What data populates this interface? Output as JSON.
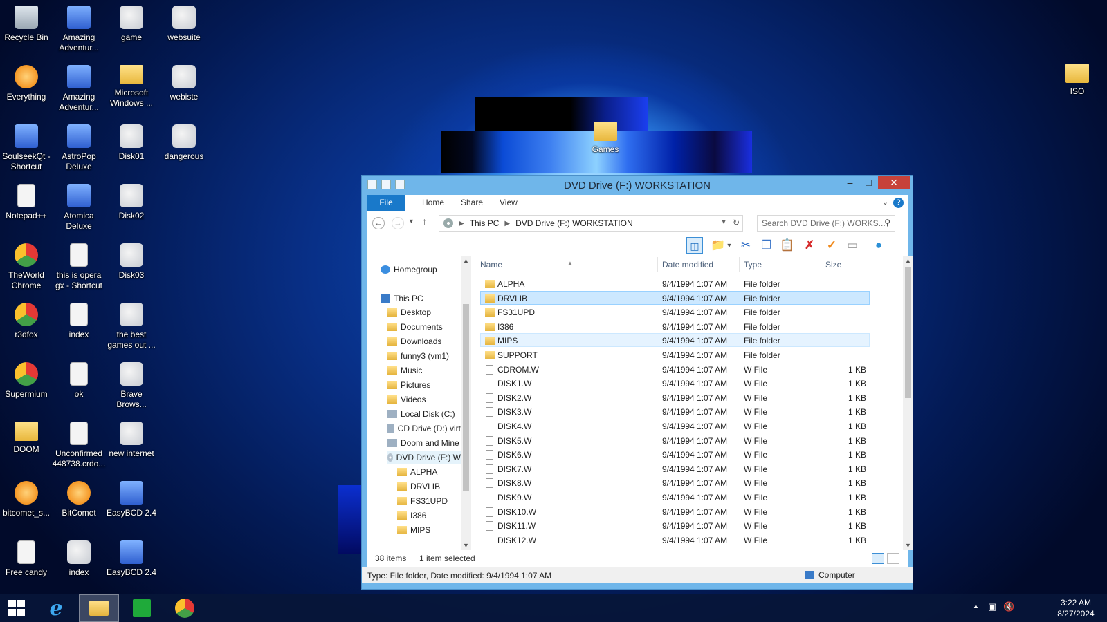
{
  "desktop": {
    "icons": [
      {
        "label": "Recycle Bin",
        "icon": "recycle-bin-icon"
      },
      {
        "label": "Amazing Adventur...",
        "icon": "game-app-icon"
      },
      {
        "label": "game",
        "icon": "globe-shortcut-icon"
      },
      {
        "label": "websuite",
        "icon": "globe-shortcut-icon"
      },
      {
        "label": "Everything",
        "icon": "search-app-icon"
      },
      {
        "label": "Amazing Adventur...",
        "icon": "game-app-icon"
      },
      {
        "label": "Microsoft Windows ...",
        "icon": "folder-icon"
      },
      {
        "label": "webiste",
        "icon": "globe-shortcut-icon"
      },
      {
        "label": "SoulseekQt - Shortcut",
        "icon": "app-icon"
      },
      {
        "label": "AstroPop Deluxe",
        "icon": "game-app-icon"
      },
      {
        "label": "Disk01",
        "icon": "disk-image-icon"
      },
      {
        "label": "dangerous",
        "icon": "globe-shortcut-icon"
      },
      {
        "label": "Notepad++",
        "icon": "notepad-icon"
      },
      {
        "label": "Atomica Deluxe",
        "icon": "game-app-icon"
      },
      {
        "label": "Disk02",
        "icon": "disk-image-icon"
      },
      {
        "label": "TheWorld Chrome",
        "icon": "browser-icon"
      },
      {
        "label": "this is opera gx - Shortcut",
        "icon": "document-icon"
      },
      {
        "label": "Disk03",
        "icon": "disk-image-icon"
      },
      {
        "label": "r3dfox",
        "icon": "browser-icon"
      },
      {
        "label": "index",
        "icon": "document-icon"
      },
      {
        "label": "the best games out ...",
        "icon": "globe-shortcut-icon"
      },
      {
        "label": "Supermium",
        "icon": "browser-icon"
      },
      {
        "label": "ok",
        "icon": "document-icon"
      },
      {
        "label": "Brave Brows...",
        "icon": "globe-shortcut-icon"
      },
      {
        "label": "DOOM",
        "icon": "folder-icon"
      },
      {
        "label": "Unconfirmed 448738.crdo...",
        "icon": "document-icon"
      },
      {
        "label": "new internet",
        "icon": "globe-shortcut-icon"
      },
      {
        "label": "bitcomet_s...",
        "icon": "bitcomet-icon"
      },
      {
        "label": "BitComet",
        "icon": "bitcomet-icon"
      },
      {
        "label": "EasyBCD 2.4",
        "icon": "app-icon"
      },
      {
        "label": "Free candy",
        "icon": "document-icon"
      },
      {
        "label": "index",
        "icon": "globe-shortcut-icon"
      },
      {
        "label": "EasyBCD 2.4",
        "icon": "app-icon"
      },
      {
        "label": "ISO",
        "icon": "folder-icon"
      },
      {
        "label": "Games",
        "icon": "folder-icon"
      }
    ]
  },
  "window": {
    "title": "DVD Drive (F:) WORKSTATION",
    "ribbon_tabs": [
      "File",
      "Home",
      "Share",
      "View"
    ],
    "address": {
      "crumbs": [
        "This PC",
        "DVD Drive (F:) WORKSTATION"
      ]
    },
    "search_placeholder": "Search DVD Drive (F:) WORKS...",
    "columns": {
      "name": "Name",
      "date": "Date modified",
      "type": "Type",
      "size": "Size"
    },
    "nav": [
      {
        "label": "Homegroup",
        "icon": "home",
        "indent": 0
      },
      {
        "label": "This PC",
        "icon": "pc",
        "indent": 0
      },
      {
        "label": "Desktop",
        "icon": "fold",
        "indent": 1
      },
      {
        "label": "Documents",
        "icon": "fold",
        "indent": 1
      },
      {
        "label": "Downloads",
        "icon": "fold",
        "indent": 1
      },
      {
        "label": "funny3 (vm1)",
        "icon": "fold",
        "indent": 1
      },
      {
        "label": "Music",
        "icon": "fold",
        "indent": 1
      },
      {
        "label": "Pictures",
        "icon": "fold",
        "indent": 1
      },
      {
        "label": "Videos",
        "icon": "fold",
        "indent": 1
      },
      {
        "label": "Local Disk (C:)",
        "icon": "drive",
        "indent": 1
      },
      {
        "label": "CD Drive (D:) virt",
        "icon": "drive",
        "indent": 1
      },
      {
        "label": "Doom and Mine",
        "icon": "drive",
        "indent": 1
      },
      {
        "label": "DVD Drive (F:) W",
        "icon": "disc",
        "indent": 1
      },
      {
        "label": "ALPHA",
        "icon": "fold",
        "indent": 2
      },
      {
        "label": "DRVLIB",
        "icon": "fold",
        "indent": 2
      },
      {
        "label": "FS31UPD",
        "icon": "fold",
        "indent": 2
      },
      {
        "label": "I386",
        "icon": "fold",
        "indent": 2
      },
      {
        "label": "MIPS",
        "icon": "fold",
        "indent": 2
      }
    ],
    "files": [
      {
        "name": "ALPHA",
        "date": "9/4/1994 1:07 AM",
        "type": "File folder",
        "size": "",
        "kind": "folder",
        "state": ""
      },
      {
        "name": "DRVLIB",
        "date": "9/4/1994 1:07 AM",
        "type": "File folder",
        "size": "",
        "kind": "folder",
        "state": "sel"
      },
      {
        "name": "FS31UPD",
        "date": "9/4/1994 1:07 AM",
        "type": "File folder",
        "size": "",
        "kind": "folder",
        "state": ""
      },
      {
        "name": "I386",
        "date": "9/4/1994 1:07 AM",
        "type": "File folder",
        "size": "",
        "kind": "folder",
        "state": ""
      },
      {
        "name": "MIPS",
        "date": "9/4/1994 1:07 AM",
        "type": "File folder",
        "size": "",
        "kind": "folder",
        "state": "hover"
      },
      {
        "name": "SUPPORT",
        "date": "9/4/1994 1:07 AM",
        "type": "File folder",
        "size": "",
        "kind": "folder",
        "state": ""
      },
      {
        "name": "CDROM.W",
        "date": "9/4/1994 1:07 AM",
        "type": "W File",
        "size": "1 KB",
        "kind": "file",
        "state": ""
      },
      {
        "name": "DISK1.W",
        "date": "9/4/1994 1:07 AM",
        "type": "W File",
        "size": "1 KB",
        "kind": "file",
        "state": ""
      },
      {
        "name": "DISK2.W",
        "date": "9/4/1994 1:07 AM",
        "type": "W File",
        "size": "1 KB",
        "kind": "file",
        "state": ""
      },
      {
        "name": "DISK3.W",
        "date": "9/4/1994 1:07 AM",
        "type": "W File",
        "size": "1 KB",
        "kind": "file",
        "state": ""
      },
      {
        "name": "DISK4.W",
        "date": "9/4/1994 1:07 AM",
        "type": "W File",
        "size": "1 KB",
        "kind": "file",
        "state": ""
      },
      {
        "name": "DISK5.W",
        "date": "9/4/1994 1:07 AM",
        "type": "W File",
        "size": "1 KB",
        "kind": "file",
        "state": ""
      },
      {
        "name": "DISK6.W",
        "date": "9/4/1994 1:07 AM",
        "type": "W File",
        "size": "1 KB",
        "kind": "file",
        "state": ""
      },
      {
        "name": "DISK7.W",
        "date": "9/4/1994 1:07 AM",
        "type": "W File",
        "size": "1 KB",
        "kind": "file",
        "state": ""
      },
      {
        "name": "DISK8.W",
        "date": "9/4/1994 1:07 AM",
        "type": "W File",
        "size": "1 KB",
        "kind": "file",
        "state": ""
      },
      {
        "name": "DISK9.W",
        "date": "9/4/1994 1:07 AM",
        "type": "W File",
        "size": "1 KB",
        "kind": "file",
        "state": ""
      },
      {
        "name": "DISK10.W",
        "date": "9/4/1994 1:07 AM",
        "type": "W File",
        "size": "1 KB",
        "kind": "file",
        "state": ""
      },
      {
        "name": "DISK11.W",
        "date": "9/4/1994 1:07 AM",
        "type": "W File",
        "size": "1 KB",
        "kind": "file",
        "state": ""
      },
      {
        "name": "DISK12.W",
        "date": "9/4/1994 1:07 AM",
        "type": "W File",
        "size": "1 KB",
        "kind": "file",
        "state": ""
      }
    ],
    "status": {
      "count": "38 items",
      "selected": "1 item selected"
    },
    "details": {
      "text": "Type: File folder, Date modified: 9/4/1994 1:07 AM",
      "location": "Computer"
    }
  },
  "taskbar": {
    "items": [
      "start-icon",
      "internet-explorer-icon",
      "file-explorer-icon",
      "store-icon",
      "chrome-icon"
    ],
    "time": "3:22 AM",
    "date": "8/27/2024"
  },
  "colors": {
    "accent": "#1979ca",
    "selection": "#cce8ff",
    "titlebar": "#6fb6ea",
    "close": "#c7423a"
  }
}
